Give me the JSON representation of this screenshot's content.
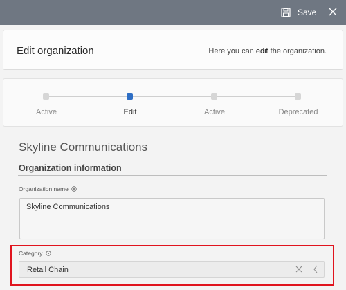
{
  "topbar": {
    "save_label": "Save",
    "save_icon": "save-icon",
    "close_icon": "close-icon"
  },
  "header": {
    "title": "Edit organization",
    "subtitle_pre": "Here you can ",
    "subtitle_em": "edit",
    "subtitle_post": " the organization."
  },
  "stepper": {
    "steps": [
      {
        "label": "Active",
        "current": false
      },
      {
        "label": "Edit",
        "current": true
      },
      {
        "label": "Active",
        "current": false
      },
      {
        "label": "Deprecated",
        "current": false
      }
    ]
  },
  "organization": {
    "name": "Skyline Communications"
  },
  "section": {
    "title": "Organization information"
  },
  "fields": {
    "org_name": {
      "label": "Organization name",
      "value": "Skyline Communications"
    },
    "category": {
      "label": "Category",
      "value": "Retail Chain"
    }
  },
  "colors": {
    "topbar": "#6f7782",
    "accent": "#2e6ec5",
    "highlight": "#e0141e"
  }
}
